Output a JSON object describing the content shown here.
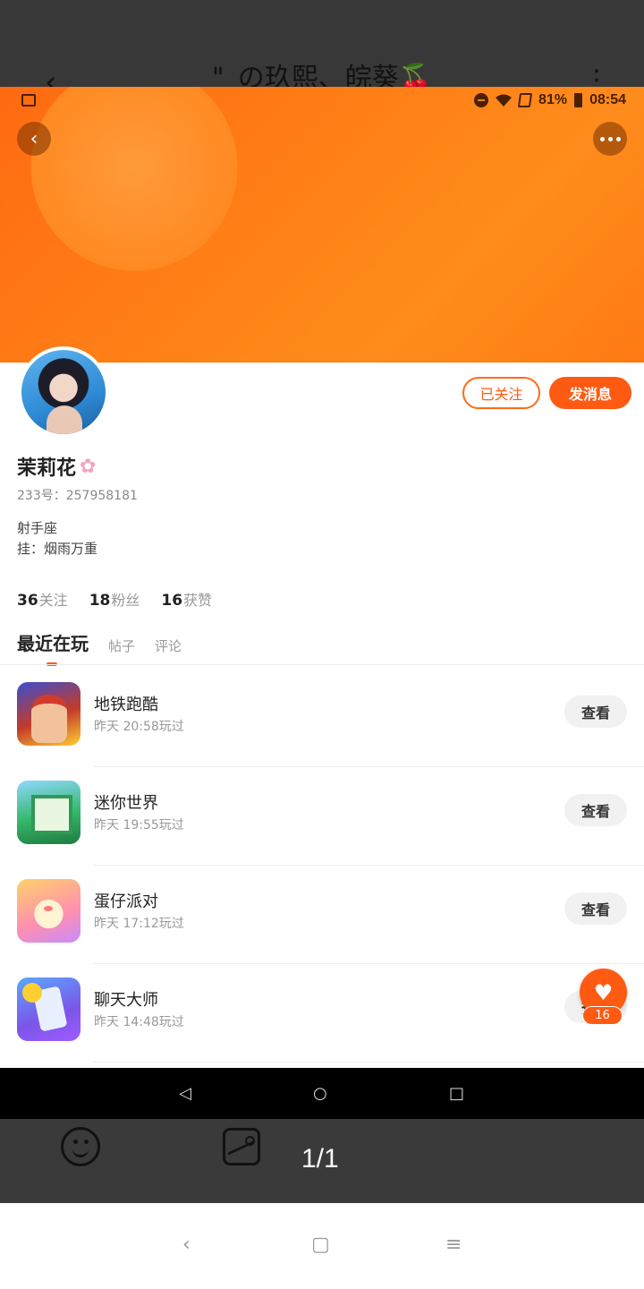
{
  "viewer": {
    "title": "\"_の玖熙、皖葵🍒",
    "back": "‹",
    "more": "⋮",
    "pager": "1/1"
  },
  "status_bar": {
    "battery": "81%",
    "time": "08:54"
  },
  "profile": {
    "name": "茉莉花",
    "name_icon": "cherry-blossom-icon",
    "uid": "233号：257958181",
    "bio_line1": "射手座",
    "bio_line2": "挂：烟雨万重",
    "follow_label": "已关注",
    "message_label": "发消息"
  },
  "stats": [
    {
      "num": "36",
      "label": "关注"
    },
    {
      "num": "18",
      "label": "粉丝"
    },
    {
      "num": "16",
      "label": "获赞"
    }
  ],
  "tabs": [
    "最近在玩",
    "帖子",
    "评论"
  ],
  "games": [
    {
      "title": "地铁跑酷",
      "time": "昨天 20:58玩过",
      "button": "查看"
    },
    {
      "title": "迷你世界",
      "time": "昨天 19:55玩过",
      "button": "查看"
    },
    {
      "title": "蛋仔派对",
      "time": "昨天 17:12玩过",
      "button": "查看"
    },
    {
      "title": "聊天大师",
      "time": "昨天 14:48玩过",
      "button": "查看"
    }
  ],
  "like": {
    "count": "16"
  },
  "colors": {
    "accent": "#ff5a12",
    "banner": "#ff7e16"
  }
}
